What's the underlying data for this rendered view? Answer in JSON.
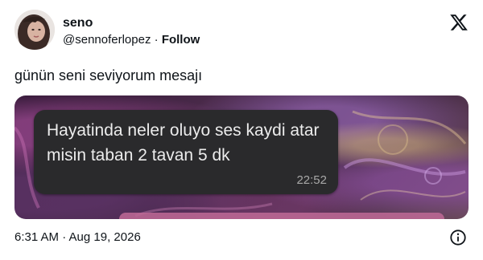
{
  "tweet": {
    "display_name": "seno",
    "handle": "@sennoferlopez",
    "separator": " · ",
    "follow_label": "Follow",
    "text": "günün seni seviyorum mesajı",
    "timestamp": "6:31 AM · Aug 19, 2026"
  },
  "media": {
    "message_text": "Hayatinda neler oluyo ses kaydi atar misin taban 2 tavan 5 dk",
    "message_time": "22:52"
  },
  "icons": {
    "brand": "x-logo-icon",
    "info": "info-icon"
  }
}
